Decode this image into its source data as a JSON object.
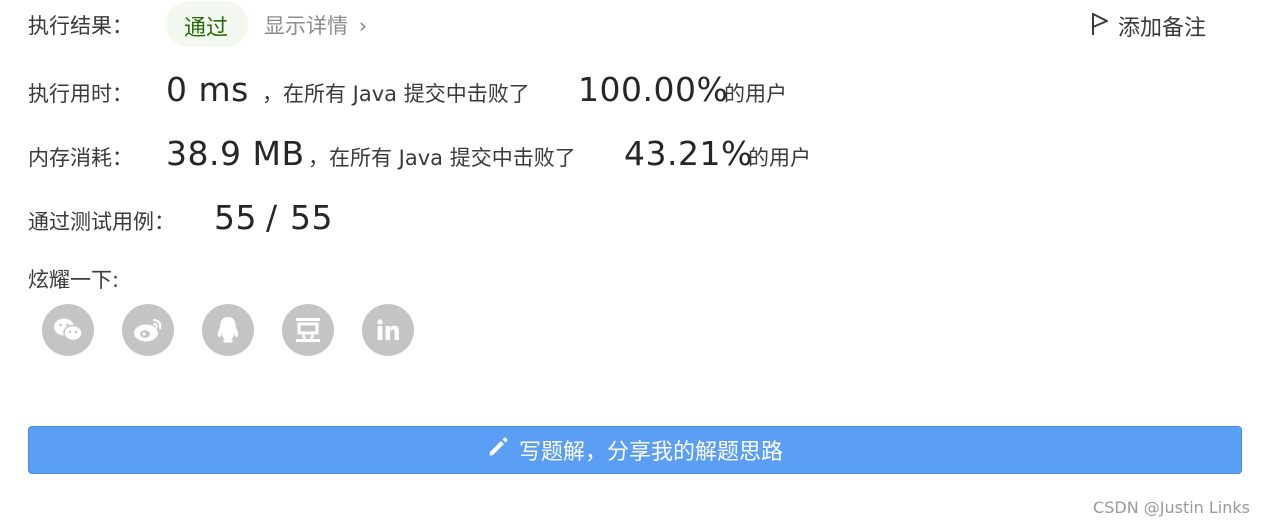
{
  "result": {
    "label": "执行结果：",
    "status": "通过",
    "details_link": "显示详情",
    "details_chevron": "›",
    "add_note": "添加备注"
  },
  "runtime": {
    "label": "执行用时：",
    "value": "0 ms",
    "middle": "，在所有 Java 提交中击败了",
    "percent": "100.00%",
    "suffix": "的用户"
  },
  "memory": {
    "label": "内存消耗：",
    "value": "38.9 MB",
    "middle": "，在所有 Java 提交中击败了",
    "percent": "43.21%",
    "suffix": "的用户"
  },
  "testcases": {
    "label": "通过测试用例：",
    "passed": "55",
    "separator": "/",
    "total": "55"
  },
  "share": {
    "label": "炫耀一下:",
    "icons": [
      "wechat-icon",
      "weibo-icon",
      "qq-icon",
      "douban-icon",
      "linkedin-icon"
    ]
  },
  "write_solution": {
    "label": "写题解，分享我的解题思路",
    "icon": "pencil-icon"
  },
  "watermark": "CSDN @Justin Links",
  "colors": {
    "primary_button": "#5b9ef5",
    "success_text": "#2b6b0a",
    "success_pill": "#f2f7ef",
    "share_icon_bg": "#c4c4c4"
  }
}
